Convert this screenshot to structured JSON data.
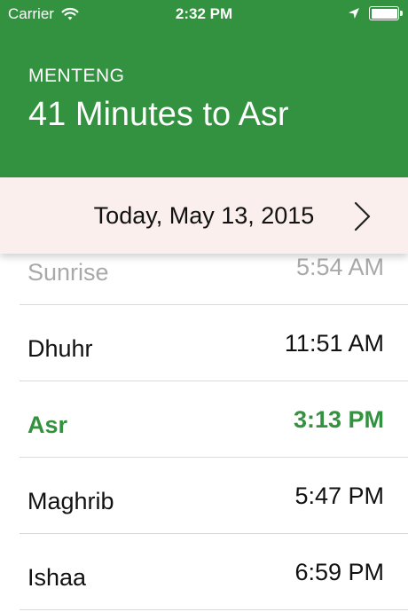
{
  "status_bar": {
    "carrier": "Carrier",
    "time": "2:32 PM",
    "icons": [
      "wifi-icon",
      "location-arrow-icon",
      "battery-icon"
    ]
  },
  "header": {
    "location": "MENTENG",
    "countdown": "41 Minutes to Asr",
    "color": "#33923f"
  },
  "date_bar": {
    "date": "Today, May 13, 2015",
    "next_icon": "chevron-right-icon",
    "background": "#fbefee"
  },
  "prayers": [
    {
      "name": "Sunrise",
      "time": "5:54 AM",
      "state": "passed"
    },
    {
      "name": "Dhuhr",
      "time": "11:51 AM",
      "state": "normal"
    },
    {
      "name": "Asr",
      "time": "3:13 PM",
      "state": "current"
    },
    {
      "name": "Maghrib",
      "time": "5:47 PM",
      "state": "normal"
    },
    {
      "name": "Ishaa",
      "time": "6:59 PM",
      "state": "normal"
    }
  ]
}
